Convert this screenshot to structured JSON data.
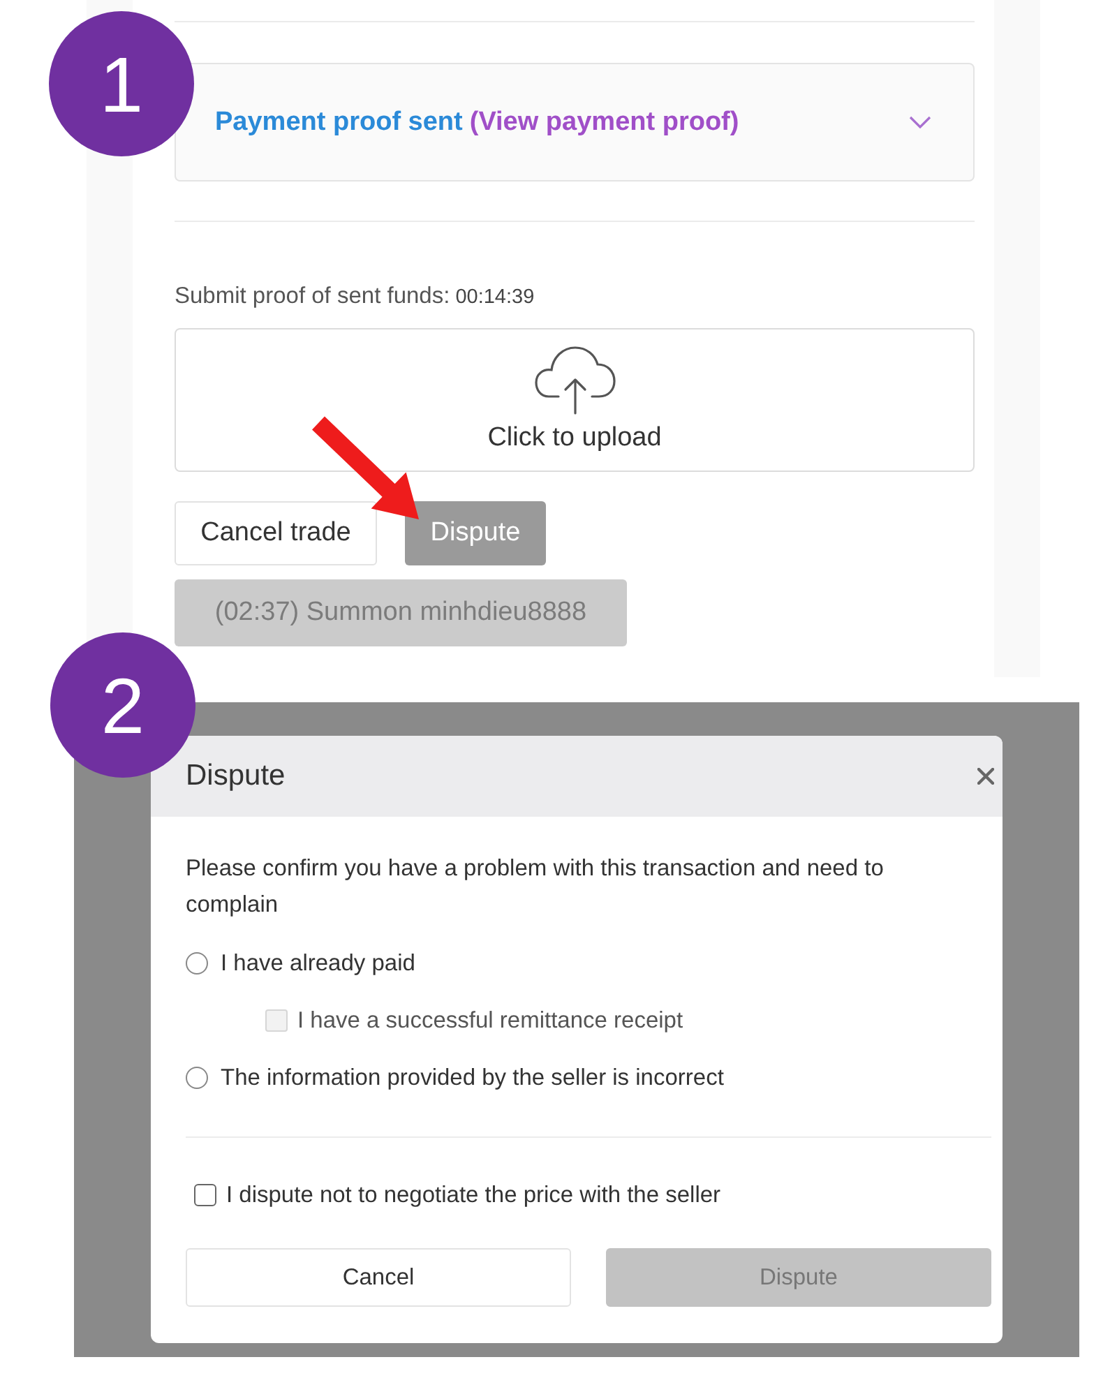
{
  "step_1": {
    "badge": "1",
    "payment_status": {
      "status": "Payment proof sent",
      "link": "(View payment proof)",
      "expanded": false
    },
    "upload": {
      "label": "Submit proof of sent funds:",
      "timer": "00:14:39",
      "button": "Click to upload"
    },
    "actions": [
      {
        "label": "Cancel trade",
        "kind": "outline"
      },
      {
        "label": "Dispute",
        "kind": "solid"
      }
    ],
    "summon": {
      "label": "(02:37) Summon minhdieu8888",
      "disabled": true
    }
  },
  "step_2": {
    "badge": "2",
    "dialog": {
      "title": "Dispute",
      "message": "Please confirm you have a problem with this transaction and need to complain",
      "options": [
        {
          "label": "I have already paid",
          "selected": false,
          "children": [
            {
              "label": "I have a successful remittance receipt",
              "checked": false,
              "disabled": true
            }
          ]
        },
        {
          "label": "The information provided by the seller is incorrect",
          "selected": false
        }
      ],
      "agreement": {
        "label": "I dispute not to negotiate the price with the seller",
        "checked": false
      },
      "buttons": [
        {
          "label": "Cancel",
          "disabled": false
        },
        {
          "label": "Dispute",
          "disabled": true
        }
      ]
    }
  }
}
